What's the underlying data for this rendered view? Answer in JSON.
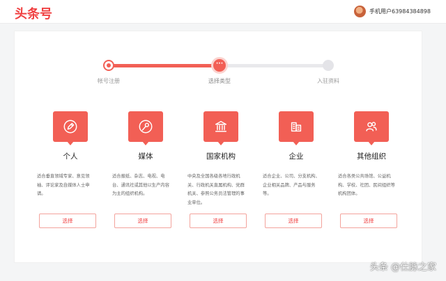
{
  "header": {
    "logo": "头条号",
    "user_name": "手机用户63984384898"
  },
  "stepper": {
    "current_step_glyph": "···",
    "steps": [
      {
        "label": "帐号注册",
        "state": "done"
      },
      {
        "label": "选择类型",
        "state": "current"
      },
      {
        "label": "入驻资料",
        "state": "todo"
      }
    ]
  },
  "types": [
    {
      "icon": "pen-icon",
      "title": "个人",
      "desc": "适合垂直领域专家、意见领袖、评论家及自媒体人士申请。",
      "button": "选择"
    },
    {
      "icon": "microphone-icon",
      "title": "媒体",
      "desc": "适合报纸、杂志、电视、电台、通讯社或其他以生产内容为主的组织机构。",
      "button": "选择"
    },
    {
      "icon": "government-building-icon",
      "title": "国家机构",
      "desc": "中央及全国各级各地行政机关、行政机关直属机构、党群机关、参照公务员法管理的事业单位。",
      "button": "选择"
    },
    {
      "icon": "enterprise-building-icon",
      "title": "企业",
      "desc": "适合企业、公司、分支机构、企业相关品牌、产品与服务等。",
      "button": "选择"
    },
    {
      "icon": "group-people-icon",
      "title": "其他组织",
      "desc": "适合各类公共场馆、公益机构、学校、社团、民间组织等机构团体。",
      "button": "选择"
    }
  ],
  "watermark": "头条 @仕脉之家",
  "colors": {
    "accent": "#f25f55",
    "brand": "#f04142",
    "track_inactive": "#e9e9ec"
  }
}
